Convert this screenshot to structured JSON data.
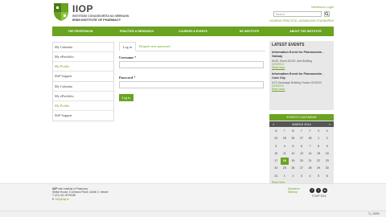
{
  "header": {
    "logo_title": "IIOP",
    "logo_sub1": "INSTITIÚID CÓGASEOIRÍTA NA hÉIREANN",
    "logo_sub2": "IRISH INSTITUTE OF PHARMACY",
    "members_login": "Members Login",
    "search_placeholder": "Search",
    "tagline": "LEADING PRACTICE • ADVANCING STANDARDS"
  },
  "nav": [
    "The Profession",
    "Practice & Research",
    "Courses & Events",
    "My Institute",
    "About the Institute"
  ],
  "sidebar_top": [
    {
      "label": "My Calendar",
      "active": false
    },
    {
      "label": "My ePortfolio",
      "active": false
    },
    {
      "label": "My Profile",
      "active": true
    },
    {
      "label": "DoP Support",
      "active": false
    }
  ],
  "sidebar_bottom": [
    {
      "label": "My Calendar",
      "active": false
    },
    {
      "label": "My ePortfolio",
      "active": false
    },
    {
      "label": "My Profile",
      "active": true
    },
    {
      "label": "DoP Support",
      "active": false
    }
  ],
  "login": {
    "tab_login": "Log in",
    "tab_reset": "Request new password",
    "username_label": "Username",
    "password_label": "Password",
    "required_mark": "*",
    "button": "Log in"
  },
  "events": {
    "title": "LATEST EVENTS",
    "items": [
      {
        "title": "Information Event for Pharmacists - Galway",
        "location": "NUIG, Room AC201, Arts Building",
        "date": "20/3/2014",
        "more": "Read more"
      },
      {
        "title": "Information Event for Pharmacists - Cork City",
        "location": "UCC Kavanagh Building, Rooms UG02/03",
        "date": "20/3/2014",
        "more": "Read more"
      }
    ]
  },
  "calendar": {
    "header": "EVENTS CALENDAR",
    "prev": "«",
    "next": "»",
    "month": "MARCH 2014",
    "dow": [
      "M",
      "T",
      "W",
      "T",
      "F",
      "S",
      "S"
    ],
    "weeks": [
      [
        "24",
        "25",
        "26",
        "27",
        "28",
        "1",
        "2"
      ],
      [
        "3",
        "4",
        "5",
        "6",
        "7",
        "8",
        "9"
      ],
      [
        "10",
        "11",
        "12",
        "13",
        "14",
        "15",
        "16"
      ],
      [
        "17",
        "18",
        "19",
        "20",
        "21",
        "22",
        "23"
      ],
      [
        "24",
        "25",
        "26",
        "27",
        "28",
        "29",
        "30"
      ],
      [
        "31",
        "1",
        "2",
        "3",
        "4",
        "5",
        "6"
      ]
    ],
    "today": "18",
    "more": "Read more"
  },
  "footer": {
    "org_short": "IIOP",
    "org_name": "Irish Institute of Pharmacy",
    "address": "Stellar House, 5 Johnson Place, Dublin 2, Ireland",
    "phone": "T: (01) 411 4079/180",
    "email_label": "E: ",
    "email": "info@iiop.ie",
    "legal_1": "Disclaimer",
    "legal_2": "Sitemap",
    "copyright": "© IIOP 2014",
    "social": [
      "f",
      "t",
      "in"
    ]
  },
  "status": {
    "zoom": "100%"
  },
  "colors": {
    "brand_green": "#6aa321"
  }
}
